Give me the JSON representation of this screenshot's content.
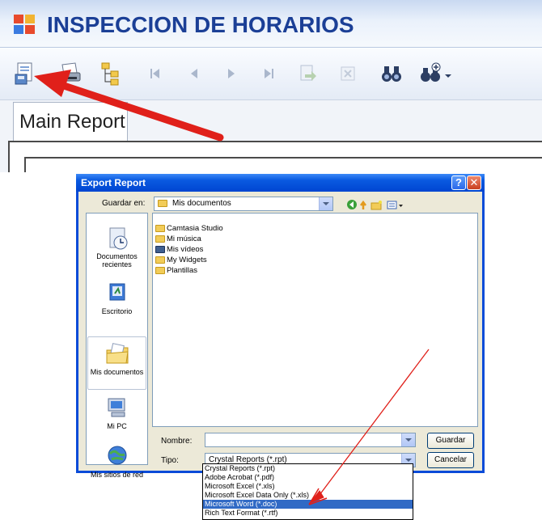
{
  "app": {
    "title": "INSPECCION DE HORARIOS",
    "tab": "Main Report",
    "toolbar_icons": [
      "export-icon",
      "print-icon",
      "group-tree-icon",
      "first-page-icon",
      "previous-page-icon",
      "next-page-icon",
      "last-page-icon",
      "goto-page-icon",
      "stop-icon",
      "search-icon",
      "zoom-icon"
    ]
  },
  "dialog": {
    "title": "Export Report",
    "guardar_en_label": "Guardar en:",
    "location": "Mis documentos",
    "places": [
      {
        "label": "Documentos recientes",
        "icon": "recent-documents-icon"
      },
      {
        "label": "Escritorio",
        "icon": "desktop-icon"
      },
      {
        "label": "Mis documentos",
        "icon": "my-documents-icon"
      },
      {
        "label": "Mi PC",
        "icon": "my-computer-icon"
      },
      {
        "label": "Mis sitios de red",
        "icon": "network-places-icon"
      }
    ],
    "files": [
      "Camtasia Studio",
      "Mi música",
      "Mis vídeos",
      "My Widgets",
      "Plantillas"
    ],
    "nombre_label": "Nombre:",
    "nombre_value": "",
    "tipo_label": "Tipo:",
    "tipo_value": "Crystal Reports (*.rpt)",
    "save_button": "Guardar",
    "cancel_button": "Cancelar",
    "tipo_options": [
      "Crystal Reports (*.rpt)",
      "Adobe Acrobat (*.pdf)",
      "Microsoft Excel (*.xls)",
      "Microsoft Excel Data Only (*.xls)",
      "Microsoft Word (*.doc)",
      "Rich Text Format (*.rtf)"
    ],
    "selected_option_index": 4
  },
  "colors": {
    "title_text": "#1b3f96",
    "dialog_titlebar": "#0a5ae0",
    "selection": "#316ac5",
    "annotation_arrow": "#e0201a"
  }
}
